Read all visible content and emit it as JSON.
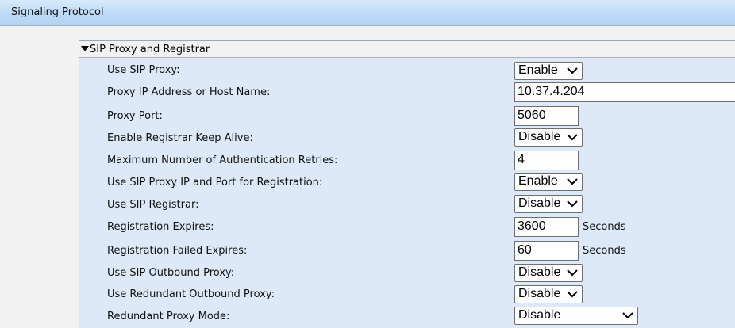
{
  "header": {
    "title": "Signaling Protocol"
  },
  "section": {
    "title": "SIP Proxy and Registrar"
  },
  "fields": {
    "use_sip_proxy": {
      "label": "Use SIP Proxy:",
      "value": "Enable"
    },
    "proxy_ip": {
      "label": "Proxy IP Address or Host Name:",
      "value": "10.37.4.204"
    },
    "proxy_port": {
      "label": "Proxy Port:",
      "value": "5060"
    },
    "registrar_keep_alive": {
      "label": "Enable Registrar Keep Alive:",
      "value": "Disable"
    },
    "max_auth_retries": {
      "label": "Maximum Number of Authentication Retries:",
      "value": "4"
    },
    "proxy_for_registration": {
      "label": "Use SIP Proxy IP and Port for Registration:",
      "value": "Enable"
    },
    "use_sip_registrar": {
      "label": "Use SIP Registrar:",
      "value": "Disable"
    },
    "registration_expires": {
      "label": "Registration Expires:",
      "value": "3600",
      "unit": "Seconds"
    },
    "registration_failed_expires": {
      "label": "Registration Failed Expires:",
      "value": "60",
      "unit": "Seconds"
    },
    "use_outbound_proxy": {
      "label": "Use SIP Outbound Proxy:",
      "value": "Disable"
    },
    "use_redundant_outbound_proxy": {
      "label": "Use Redundant Outbound Proxy:",
      "value": "Disable"
    },
    "redundant_proxy_mode": {
      "label": "Redundant Proxy Mode:",
      "value": "Disable"
    }
  }
}
